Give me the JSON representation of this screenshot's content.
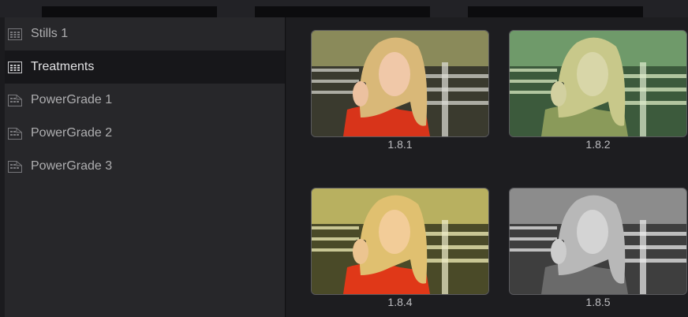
{
  "albums": [
    {
      "label": "Stills 1",
      "icon": "stills-album-icon",
      "selected": false
    },
    {
      "label": "Treatments",
      "icon": "stills-album-icon",
      "selected": true
    },
    {
      "label": "PowerGrade 1",
      "icon": "powergrade-album-icon",
      "selected": false
    },
    {
      "label": "PowerGrade 2",
      "icon": "powergrade-album-icon",
      "selected": false
    },
    {
      "label": "PowerGrade 3",
      "icon": "powergrade-album-icon",
      "selected": false
    }
  ],
  "stills": [
    {
      "label": "1.8.1",
      "treatment": "natural"
    },
    {
      "label": "1.8.2",
      "treatment": "green"
    },
    {
      "label": "1.8.4",
      "treatment": "warm"
    },
    {
      "label": "1.8.5",
      "treatment": "mono"
    }
  ]
}
